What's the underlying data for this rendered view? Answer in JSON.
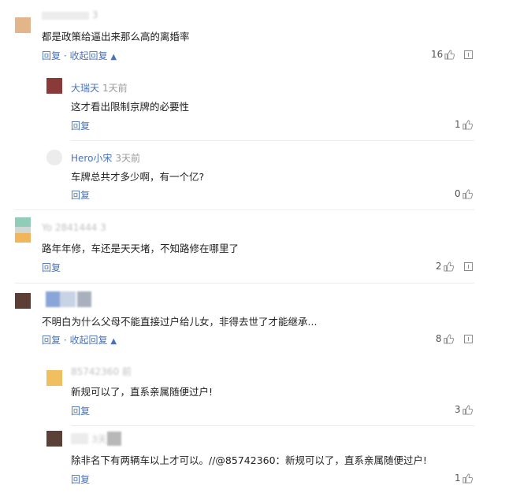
{
  "comments": [
    {
      "username": "",
      "time": "3",
      "content": "都是政策给逼出来那么高的离婚率",
      "reply_label": "回复",
      "collapse_label": "收起回复",
      "likes": "16",
      "avatar_color": "#e2b68a"
    },
    {
      "username": "大瑞天",
      "time": "1天前",
      "content": "这才看出限制京牌的必要性",
      "reply_label": "回复",
      "likes": "1",
      "avatar_color": "#8b3a3a"
    },
    {
      "username": "Hero小宋",
      "time": "3天前",
      "content": "车牌总共才多少啊，有一个亿?",
      "reply_label": "回复",
      "likes": "0",
      "avatar_color": "#e6e6e6"
    },
    {
      "username": "Yo",
      "time": "2841444 3",
      "content": "路年年修，车还是天天堵，不知路修在哪里了",
      "reply_label": "回复",
      "likes": "2",
      "avatar_color": "#8fcdb8"
    },
    {
      "username": "",
      "time": "",
      "content": "不明白为什么父母不能直接过户给儿女，非得去世了才能继承...",
      "reply_label": "回复",
      "collapse_label": "收起回复",
      "likes": "8",
      "avatar_color": "#5b3f36"
    },
    {
      "username": "85742360",
      "time": "前",
      "content": "新规可以了，直系亲属随便过户!",
      "reply_label": "回复",
      "likes": "3",
      "avatar_color": "#f0c060"
    },
    {
      "username": "",
      "time": "3天",
      "content": "除非名下有两辆车以上才可以。//@85742360：新规可以了，直系亲属随便过户!",
      "reply_label": "回复",
      "likes": "1",
      "avatar_color": "#5a4036"
    }
  ],
  "separator": "·"
}
